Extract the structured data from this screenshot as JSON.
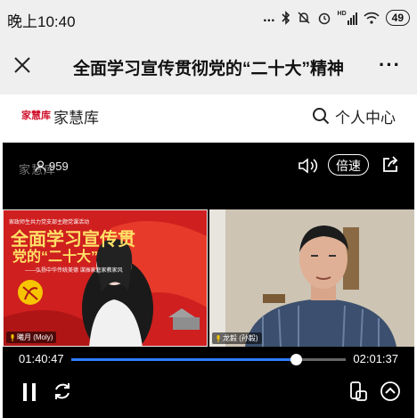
{
  "status": {
    "time": "晚上10:40",
    "dots": "...",
    "battery": "49",
    "hd_label": "HD"
  },
  "header": {
    "title": "全面学习宣传贯彻党的“二十大”精神",
    "more": "···"
  },
  "site": {
    "logo_text": "家慧库",
    "name": "家慧库",
    "user_center": "个人中心"
  },
  "video": {
    "watermark": "家慧库",
    "viewers": "959",
    "speed_label": "倍速",
    "poster": {
      "top_line": "家政师生共力党支部主题党课活动",
      "line1": "全面学习宣传贯",
      "line2": "党的“二十大”",
      "sub": "——弘扬中华传统美德 谋振家庭家教家风"
    },
    "left_name": "曦月 (Moly)",
    "right_name": "龙毅 (孙毅)",
    "current_time": "01:40:47",
    "total_time": "02:01:37",
    "progress": 0.817
  }
}
